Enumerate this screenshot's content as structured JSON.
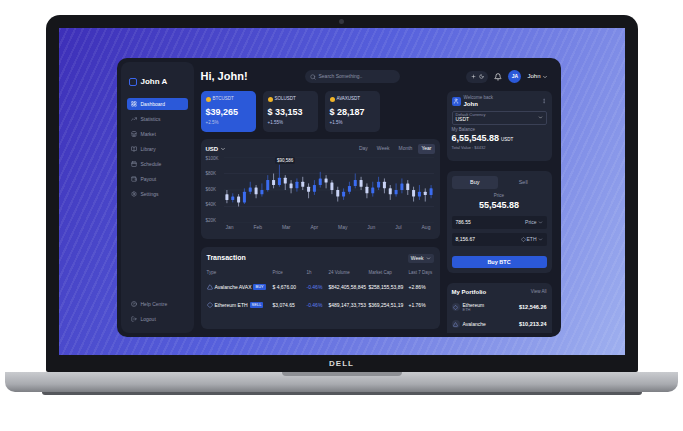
{
  "laptop": {
    "brand": "DELL"
  },
  "sidebar": {
    "title": "John A",
    "items": [
      {
        "label": "Dashboard",
        "selected": true
      },
      {
        "label": "Statistics",
        "selected": false
      },
      {
        "label": "Market",
        "selected": false
      },
      {
        "label": "Library",
        "selected": false
      },
      {
        "label": "Schedule",
        "selected": false
      },
      {
        "label": "Payout",
        "selected": false
      },
      {
        "label": "Settings",
        "selected": false
      }
    ],
    "footer_items": [
      {
        "label": "Help Centre"
      },
      {
        "label": "Logout"
      }
    ]
  },
  "header": {
    "greeting": "Hi, John!",
    "search": {
      "placeholder": "Search Something.."
    },
    "avatar": "JA",
    "user": "John"
  },
  "tickers": [
    {
      "pair": "BTCUSDT",
      "price": "$39,265",
      "change": "+2.5%",
      "selected": true
    },
    {
      "pair": "SOLUSDT",
      "price": "$ 33,153",
      "change": "+1.55%",
      "selected": false
    },
    {
      "pair": "AVAXUSDT",
      "price": "$ 28,187",
      "change": "+1.5%",
      "selected": false
    }
  ],
  "chart": {
    "currency": "USD",
    "ranges": [
      {
        "label": "Day",
        "selected": false
      },
      {
        "label": "Week",
        "selected": false
      },
      {
        "label": "Month",
        "selected": false
      },
      {
        "label": "Year",
        "selected": true
      }
    ],
    "y_ticks": [
      "$100K",
      "$80K",
      "$60K",
      "$40K",
      "$20K"
    ],
    "y_range": [
      20000,
      100000
    ],
    "x_ticks": [
      "Jan",
      "Feb",
      "Mar",
      "Apr",
      "May",
      "Jun",
      "Jul",
      "Aug"
    ],
    "tooltip": "$90,586",
    "candles": [
      {
        "open": 55000,
        "close": 48000,
        "high": 60000,
        "low": 44000
      },
      {
        "open": 48000,
        "close": 52000,
        "high": 56000,
        "low": 45000
      },
      {
        "open": 52000,
        "close": 45000,
        "high": 55000,
        "low": 40000
      },
      {
        "open": 45000,
        "close": 58000,
        "high": 62000,
        "low": 43000
      },
      {
        "open": 58000,
        "close": 63000,
        "high": 70000,
        "low": 55000
      },
      {
        "open": 63000,
        "close": 55000,
        "high": 66000,
        "low": 50000
      },
      {
        "open": 55000,
        "close": 60000,
        "high": 68000,
        "low": 52000
      },
      {
        "open": 60000,
        "close": 72000,
        "high": 78000,
        "low": 58000
      },
      {
        "open": 72000,
        "close": 66000,
        "high": 80000,
        "low": 62000
      },
      {
        "open": 66000,
        "close": 75000,
        "high": 90586,
        "low": 64000
      },
      {
        "open": 75000,
        "close": 68000,
        "high": 78000,
        "low": 60000
      },
      {
        "open": 68000,
        "close": 62000,
        "high": 72000,
        "low": 56000
      },
      {
        "open": 62000,
        "close": 70000,
        "high": 74000,
        "low": 58000
      },
      {
        "open": 70000,
        "close": 64000,
        "high": 76000,
        "low": 60000
      },
      {
        "open": 64000,
        "close": 58000,
        "high": 68000,
        "low": 50000
      },
      {
        "open": 58000,
        "close": 66000,
        "high": 72000,
        "low": 54000
      },
      {
        "open": 66000,
        "close": 74000,
        "high": 82000,
        "low": 63000
      },
      {
        "open": 74000,
        "close": 69000,
        "high": 78000,
        "low": 62000
      },
      {
        "open": 69000,
        "close": 60000,
        "high": 72000,
        "low": 55000
      },
      {
        "open": 60000,
        "close": 52000,
        "high": 64000,
        "low": 46000
      },
      {
        "open": 52000,
        "close": 58000,
        "high": 62000,
        "low": 48000
      },
      {
        "open": 58000,
        "close": 65000,
        "high": 70000,
        "low": 55000
      },
      {
        "open": 65000,
        "close": 72000,
        "high": 80000,
        "low": 62000
      },
      {
        "open": 72000,
        "close": 64000,
        "high": 76000,
        "low": 60000
      },
      {
        "open": 64000,
        "close": 56000,
        "high": 68000,
        "low": 50000
      },
      {
        "open": 56000,
        "close": 63000,
        "high": 70000,
        "low": 52000
      },
      {
        "open": 63000,
        "close": 70000,
        "high": 76000,
        "low": 60000
      },
      {
        "open": 70000,
        "close": 62000,
        "high": 74000,
        "low": 56000
      },
      {
        "open": 62000,
        "close": 55000,
        "high": 66000,
        "low": 48000
      },
      {
        "open": 55000,
        "close": 60000,
        "high": 68000,
        "low": 52000
      },
      {
        "open": 60000,
        "close": 68000,
        "high": 74000,
        "low": 56000
      },
      {
        "open": 68000,
        "close": 60000,
        "high": 72000,
        "low": 54000
      },
      {
        "open": 60000,
        "close": 52000,
        "high": 64000,
        "low": 46000
      },
      {
        "open": 52000,
        "close": 58000,
        "high": 66000,
        "low": 48000
      },
      {
        "open": 58000,
        "close": 54000,
        "high": 62000,
        "low": 46000
      },
      {
        "open": 54000,
        "close": 62000,
        "high": 66000,
        "low": 50000
      }
    ]
  },
  "transactions": {
    "title": "Transaction",
    "period": "Week",
    "columns": [
      "Type",
      "Price",
      "1h",
      "24 Volume",
      "Market Cap",
      "Last 7 Days"
    ],
    "rows": [
      {
        "name": "Avalanche AVAX",
        "side": "BUY",
        "price": "$ 4,676.00",
        "change_1h": "-0.46%",
        "volume_24h": "$842,405,58,845",
        "market_cap": "$258,155,53,89",
        "last_7_days": "+2.86%"
      },
      {
        "name": "Ethereum ETH",
        "side": "SELL",
        "price": "$3,074.65",
        "change_1h": "-0.46%",
        "volume_24h": "$489,147,33,753",
        "market_cap": "$369,254,51,19",
        "last_7_days": "+1.76%"
      }
    ]
  },
  "wallet": {
    "welcome": "Welcome back",
    "name": "John",
    "currency_label": "Default Currency",
    "currency": "USDT",
    "balance_label": "My Balance",
    "balance": "6,55,545.88",
    "balance_unit": "USDT",
    "total_value": "Total Value : $4432"
  },
  "trade": {
    "tabs": [
      {
        "label": "Buy",
        "selected": true
      },
      {
        "label": "Sell",
        "selected": false
      }
    ],
    "price_label": "Price",
    "price": "55,545.88",
    "fields": [
      {
        "value": "786.55",
        "unit": "Price"
      },
      {
        "value": "8,156.67",
        "unit": "ETH"
      }
    ],
    "button": "Buy BTC"
  },
  "portfolio": {
    "title": "My Portfolio",
    "link": "View All",
    "assets": [
      {
        "name": "Ethereum",
        "symbol": "ETH",
        "value": "$12,546.26"
      },
      {
        "name": "Avalanche",
        "value": "$10,213.24"
      }
    ]
  }
}
